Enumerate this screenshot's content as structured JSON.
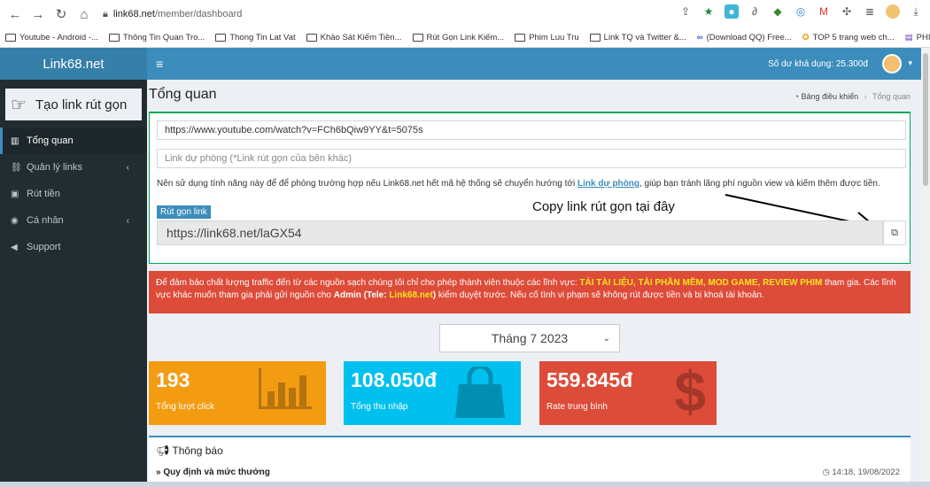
{
  "browser": {
    "url_host": "link68.net",
    "url_path": "/member/dashboard"
  },
  "bookmarks": [
    "Youtube - Android -...",
    "Thông Tin Quan Tro...",
    "Thong Tin Lat Vat",
    "Khảo Sát Kiếm Tiền...",
    "Rút Gọn Link Kiếm...",
    "Phim Luu Tru",
    "Link TQ và Twitter &...",
    "(Download QQ) Free...",
    "TOP 5 trang web ch...",
    "PHIẾU ĐĂNG KÝ TH..."
  ],
  "header": {
    "logo": "Link68.net",
    "hamburger": "≡",
    "balance": "Số dư khả dụng: 25.300đ"
  },
  "sidebar": {
    "create_link": "Tạo link rút gọn",
    "items": [
      {
        "label": "Tổng quan",
        "icon": "▥"
      },
      {
        "label": "Quản lý links",
        "icon": "⛓"
      },
      {
        "label": "Rút tiền",
        "icon": "▣"
      },
      {
        "label": "Cá nhân",
        "icon": "◉"
      },
      {
        "label": "Support",
        "icon": "◀"
      }
    ],
    "chevron": "‹"
  },
  "page": {
    "title": "Tổng quan",
    "breadcrumb_home": "Bảng điều khiển",
    "breadcrumb_sep": "›",
    "breadcrumb_current": "Tổng quan"
  },
  "form": {
    "long_url": "https://www.youtube.com/watch?v=FCh6bQiw9YY&t=5075s",
    "backup_placeholder": "Link dự phòng (*Link rút gọn của bên khác)",
    "note_before": "Nên sử dụng tính năng này để để phòng trường hợp nếu Link68.net hết mã hệ thống sẽ chuyển hướng tới ",
    "note_link": "Link dự phòng",
    "note_after": ", giúp bạn tránh lãng phí nguồn view và kiếm thêm được tiền.",
    "short_label": "Rút gọn link",
    "short_result": "https://link68.net/laGX54",
    "annotation": "Copy link rút gọn tại đây"
  },
  "alert": {
    "p1": "Để đảm bảo chất lượng traffic đến từ các nguồn sạch chúng tôi chỉ cho phép thành viên thuộc các lĩnh vực: ",
    "categories": "TẢI TÀI LIỆU, TẢI PHẦN MỀM, MOD GAME, REVIEW PHIM",
    "p2": " tham gia. Các lĩnh vực khác muốn tham gia phải gửi nguồn cho ",
    "admin": "Admin (Tele: ",
    "tele": "Link68.net",
    "admin_close": ")",
    "p3": " kiểm duyệt trước. Nếu cố tình vi phạm sẽ không rút được tiền và bị khoá tài khoản."
  },
  "month": {
    "selected": "Tháng 7 2023"
  },
  "stats": [
    {
      "value": "193",
      "label": "Tổng lượt click",
      "color": "#f39c12"
    },
    {
      "value": "108.050đ",
      "label": "Tổng thu nhập",
      "color": "#00c0ef"
    },
    {
      "value": "559.845đ",
      "label": "Rate trung bình",
      "color": "#dd4b39"
    }
  ],
  "notice": {
    "title": "Thông báo",
    "item": "» Quy định và mức thưởng",
    "time": "14:18, 19/08/2022"
  }
}
